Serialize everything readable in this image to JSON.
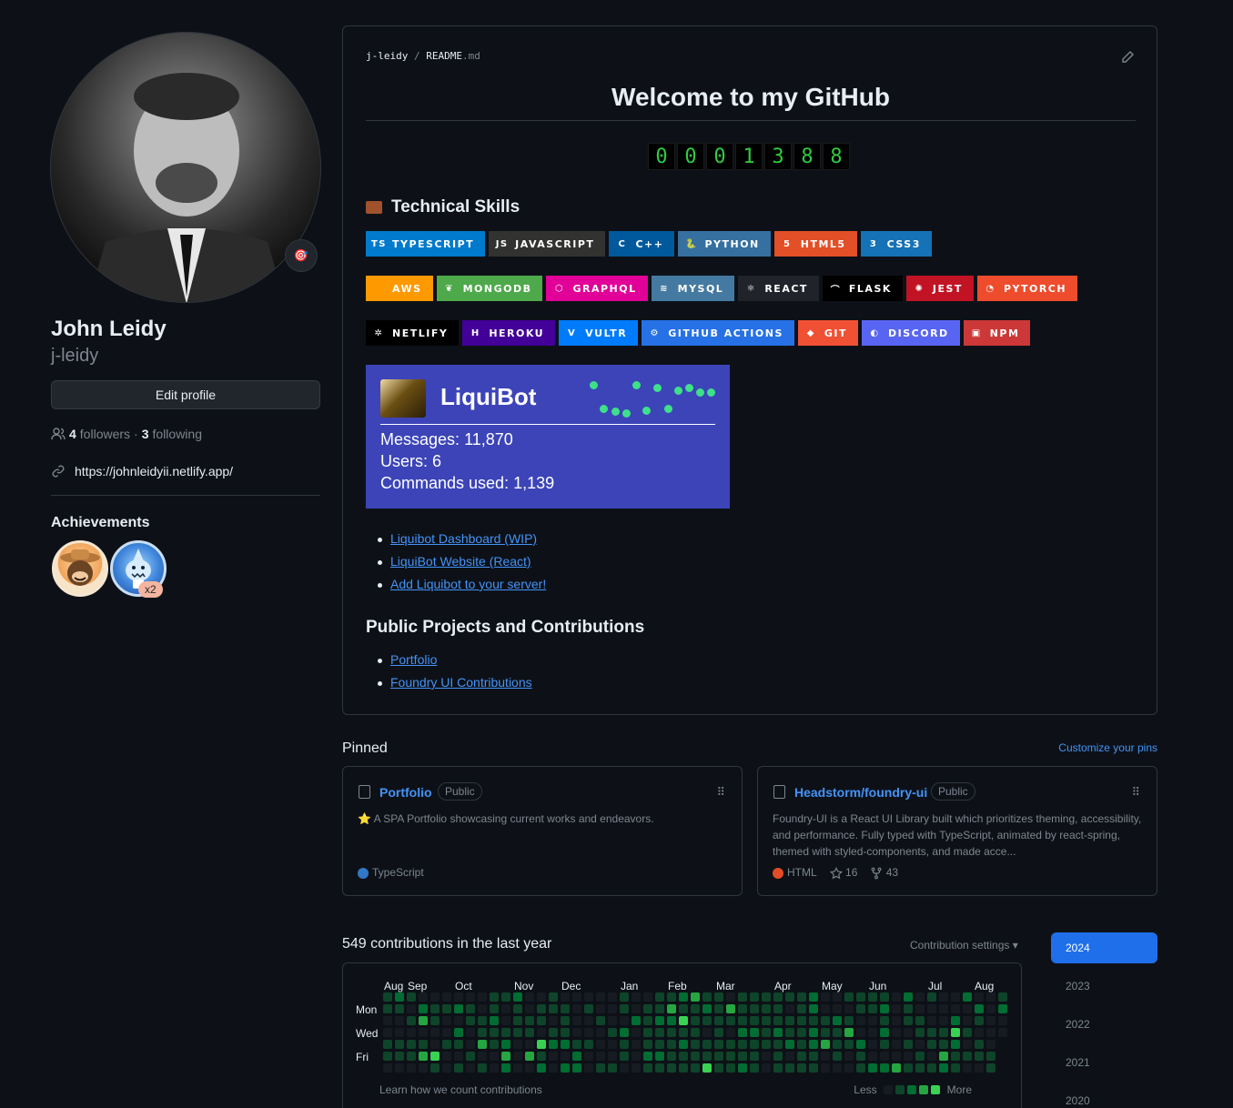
{
  "profile": {
    "name": "John Leidy",
    "login": "j-leidy",
    "edit_label": "Edit profile",
    "followers_count": "4",
    "followers_label": "followers",
    "following_count": "3",
    "following_label": "following",
    "separator": "·",
    "website": "https://johnleidyii.netlify.app/",
    "achievements_title": "Achievements",
    "achievement_badge_count": "x2"
  },
  "readme": {
    "crumb_owner": "j-leidy",
    "crumb_sep": "/",
    "crumb_file": "README",
    "crumb_ext": ".md",
    "title": "Welcome to my GitHub",
    "counter": [
      "0",
      "0",
      "0",
      "1",
      "3",
      "8",
      "8"
    ],
    "skills_heading": "Technical Skills",
    "skill_rows": [
      [
        {
          "label": "TYPESCRIPT",
          "color": "#007acc",
          "icon": "TS"
        },
        {
          "label": "JAVASCRIPT",
          "color": "#323330",
          "icon": "JS"
        },
        {
          "label": "C++",
          "color": "#00599c",
          "icon": "C"
        },
        {
          "label": "PYTHON",
          "color": "#3670a0",
          "icon": "🐍"
        },
        {
          "label": "HTML5",
          "color": "#e34f26",
          "icon": "5"
        },
        {
          "label": "CSS3",
          "color": "#1572b6",
          "icon": "3"
        }
      ],
      [
        {
          "label": "AWS",
          "color": "#ff9900",
          "icon": ""
        },
        {
          "label": "MONGODB",
          "color": "#4ea94b",
          "icon": "❦"
        },
        {
          "label": "GRAPHQL",
          "color": "#e10098",
          "icon": "⬡"
        },
        {
          "label": "MYSQL",
          "color": "#4479a1",
          "icon": "≋"
        },
        {
          "label": "REACT",
          "color": "#20232a",
          "icon": "⚛"
        },
        {
          "label": "FLASK",
          "color": "#000000",
          "icon": "⌒"
        },
        {
          "label": "JEST",
          "color": "#c21325",
          "icon": "✺"
        },
        {
          "label": "PYTORCH",
          "color": "#ee4c2c",
          "icon": "◔"
        }
      ],
      [
        {
          "label": "NETLIFY",
          "color": "#000000",
          "icon": "✲"
        },
        {
          "label": "HEROKU",
          "color": "#430098",
          "icon": "H"
        },
        {
          "label": "VULTR",
          "color": "#007bfc",
          "icon": "V"
        },
        {
          "label": "GITHUB ACTIONS",
          "color": "#2671e5",
          "icon": "⚙"
        },
        {
          "label": "GIT",
          "color": "#f05033",
          "icon": "◆"
        },
        {
          "label": "DISCORD",
          "color": "#5865f2",
          "icon": "◐"
        },
        {
          "label": "NPM",
          "color": "#cb3837",
          "icon": "▣"
        }
      ]
    ],
    "bot": {
      "name": "LiquiBot",
      "messages_label": "Messages:",
      "messages_value": "11,870",
      "users_label": "Users:",
      "users_value": "6",
      "commands_label": "Commands used:",
      "commands_value": "1,139"
    },
    "bot_links": [
      "Liquibot Dashboard (WIP)",
      "LiquiBot Website (React)",
      "Add Liquibot to your server!"
    ],
    "projects_heading": "Public Projects and Contributions",
    "project_links": [
      "Portfolio",
      "Foundry UI Contributions"
    ]
  },
  "pinned": {
    "title": "Pinned",
    "customize": "Customize your pins",
    "cards": [
      {
        "name": "Portfolio",
        "visibility": "Public",
        "description": "⭐ A SPA Portfolio showcasing current works and endeavors.",
        "language": "TypeScript",
        "language_color": "#3178c6"
      },
      {
        "name": "Headstorm/foundry-ui",
        "visibility": "Public",
        "description": "Foundry-UI is a React UI Library built which prioritizes theming, accessibility, and performance. Fully typed with TypeScript, animated by react-spring, themed with styled-components, and made acce...",
        "language": "HTML",
        "language_color": "#e34c26",
        "stars": "16",
        "forks": "43"
      }
    ]
  },
  "contributions": {
    "title": "549 contributions in the last year",
    "settings": "Contribution settings",
    "months": [
      "Aug",
      "Sep",
      "Oct",
      "Nov",
      "Dec",
      "Jan",
      "Feb",
      "Mar",
      "Apr",
      "May",
      "Jun",
      "Jul",
      "Aug"
    ],
    "days": [
      "Mon",
      "Wed",
      "Fri"
    ],
    "learn": "Learn how we count contributions",
    "less": "Less",
    "more": "More",
    "years": [
      "2024",
      "2023",
      "2022",
      "2021",
      "2020"
    ],
    "level_colors": [
      "#161b22",
      "#0e4429",
      "#006d32",
      "#26a641",
      "#39d353"
    ]
  }
}
